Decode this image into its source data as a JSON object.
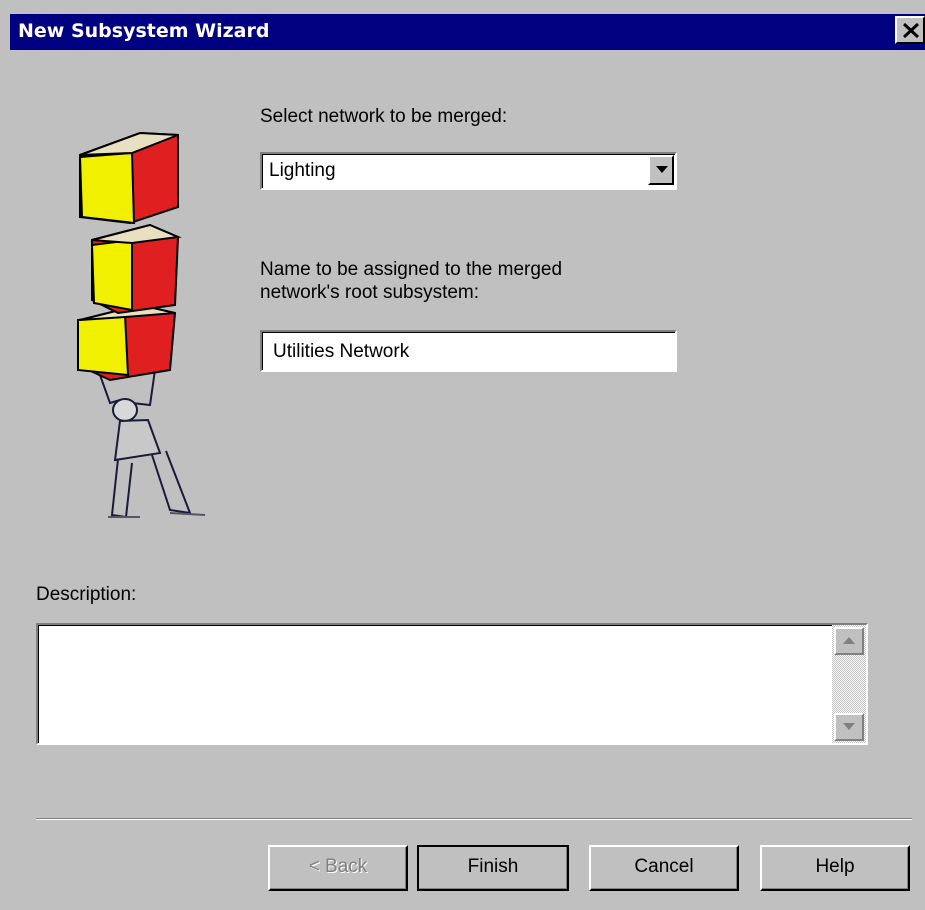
{
  "window": {
    "title": "New Subsystem Wizard"
  },
  "network_select": {
    "label": "Select network to be merged:",
    "value": "Lighting"
  },
  "name_field": {
    "label_line1": "Name to be assigned to the merged",
    "label_line2": "network's root subsystem:",
    "value": "Utilities Network"
  },
  "description": {
    "label": "Description:",
    "value": ""
  },
  "buttons": {
    "back": "< Back",
    "finish": "Finish",
    "cancel": "Cancel",
    "help": "Help"
  },
  "colors": {
    "titlebar": "#000080",
    "face": "#c0c0c0",
    "cube_red": "#e02020",
    "cube_yellow": "#f0f000"
  }
}
